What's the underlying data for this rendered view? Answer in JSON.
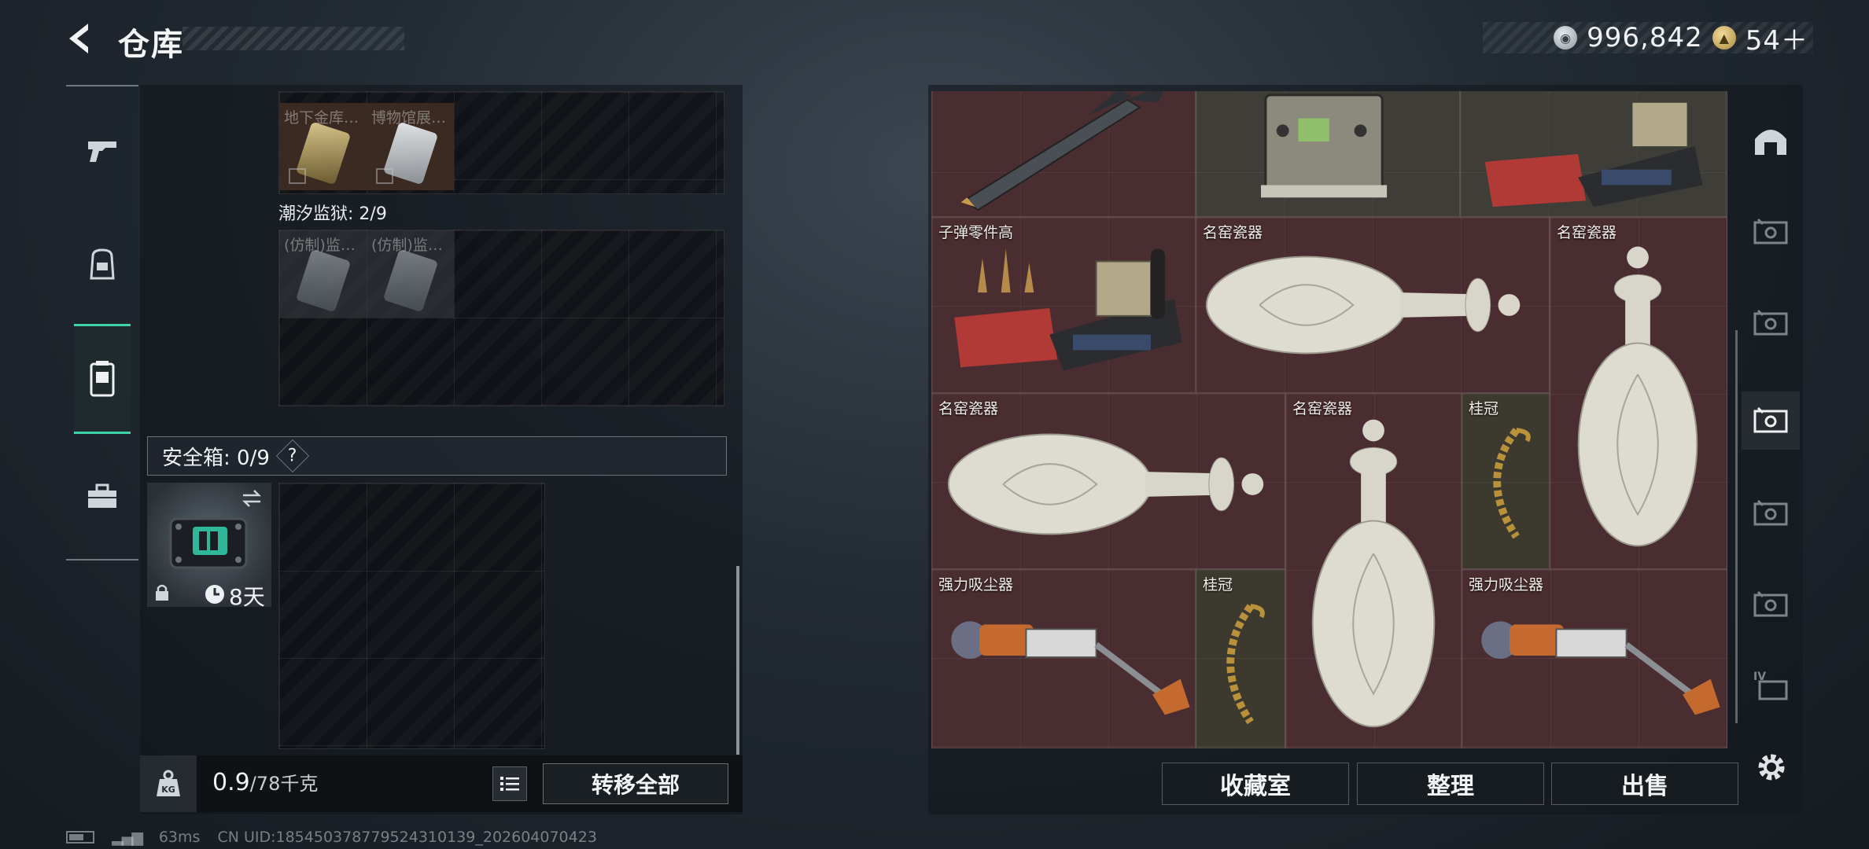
{
  "header": {
    "title": "仓库"
  },
  "currency": {
    "silver_value": "996,842",
    "silver_icon": "silver-coin-icon",
    "gold_value": "54＋",
    "gold_icon": "gold-coin-icon"
  },
  "left_nav": [
    "pistol-icon",
    "backpack-icon",
    "storage-case-icon",
    "toolbox-icon"
  ],
  "storage": {
    "top_slots": [
      "地下金库…",
      "博物馆展…"
    ],
    "prison_label": "潮汐监狱: 2/9",
    "prison_slots": [
      "(仿制)监…",
      "(仿制)监…"
    ],
    "secure_box_label": "安全箱: 0/9",
    "secure_help": "?",
    "secure_timer": "8天",
    "weight_value": "0.9",
    "weight_max": "/78千克",
    "transfer_all": "转移全部"
  },
  "collection": {
    "items": [
      "子弹零件高",
      "名窑瓷器",
      "名窑瓷器",
      "名窑瓷器",
      "名窑瓷器",
      "桂冠",
      "强力吸尘器",
      "桂冠",
      "强力吸尘器"
    ]
  },
  "actions": {
    "collection_room": "收藏室",
    "organize": "整理",
    "sell": "出售"
  },
  "status": {
    "ping": "63ms",
    "uid": "CN UID:185450378779524310139_202604070423"
  },
  "colors": {
    "accent": "#3fd3a8",
    "collection_bg": "#4a2d31"
  }
}
